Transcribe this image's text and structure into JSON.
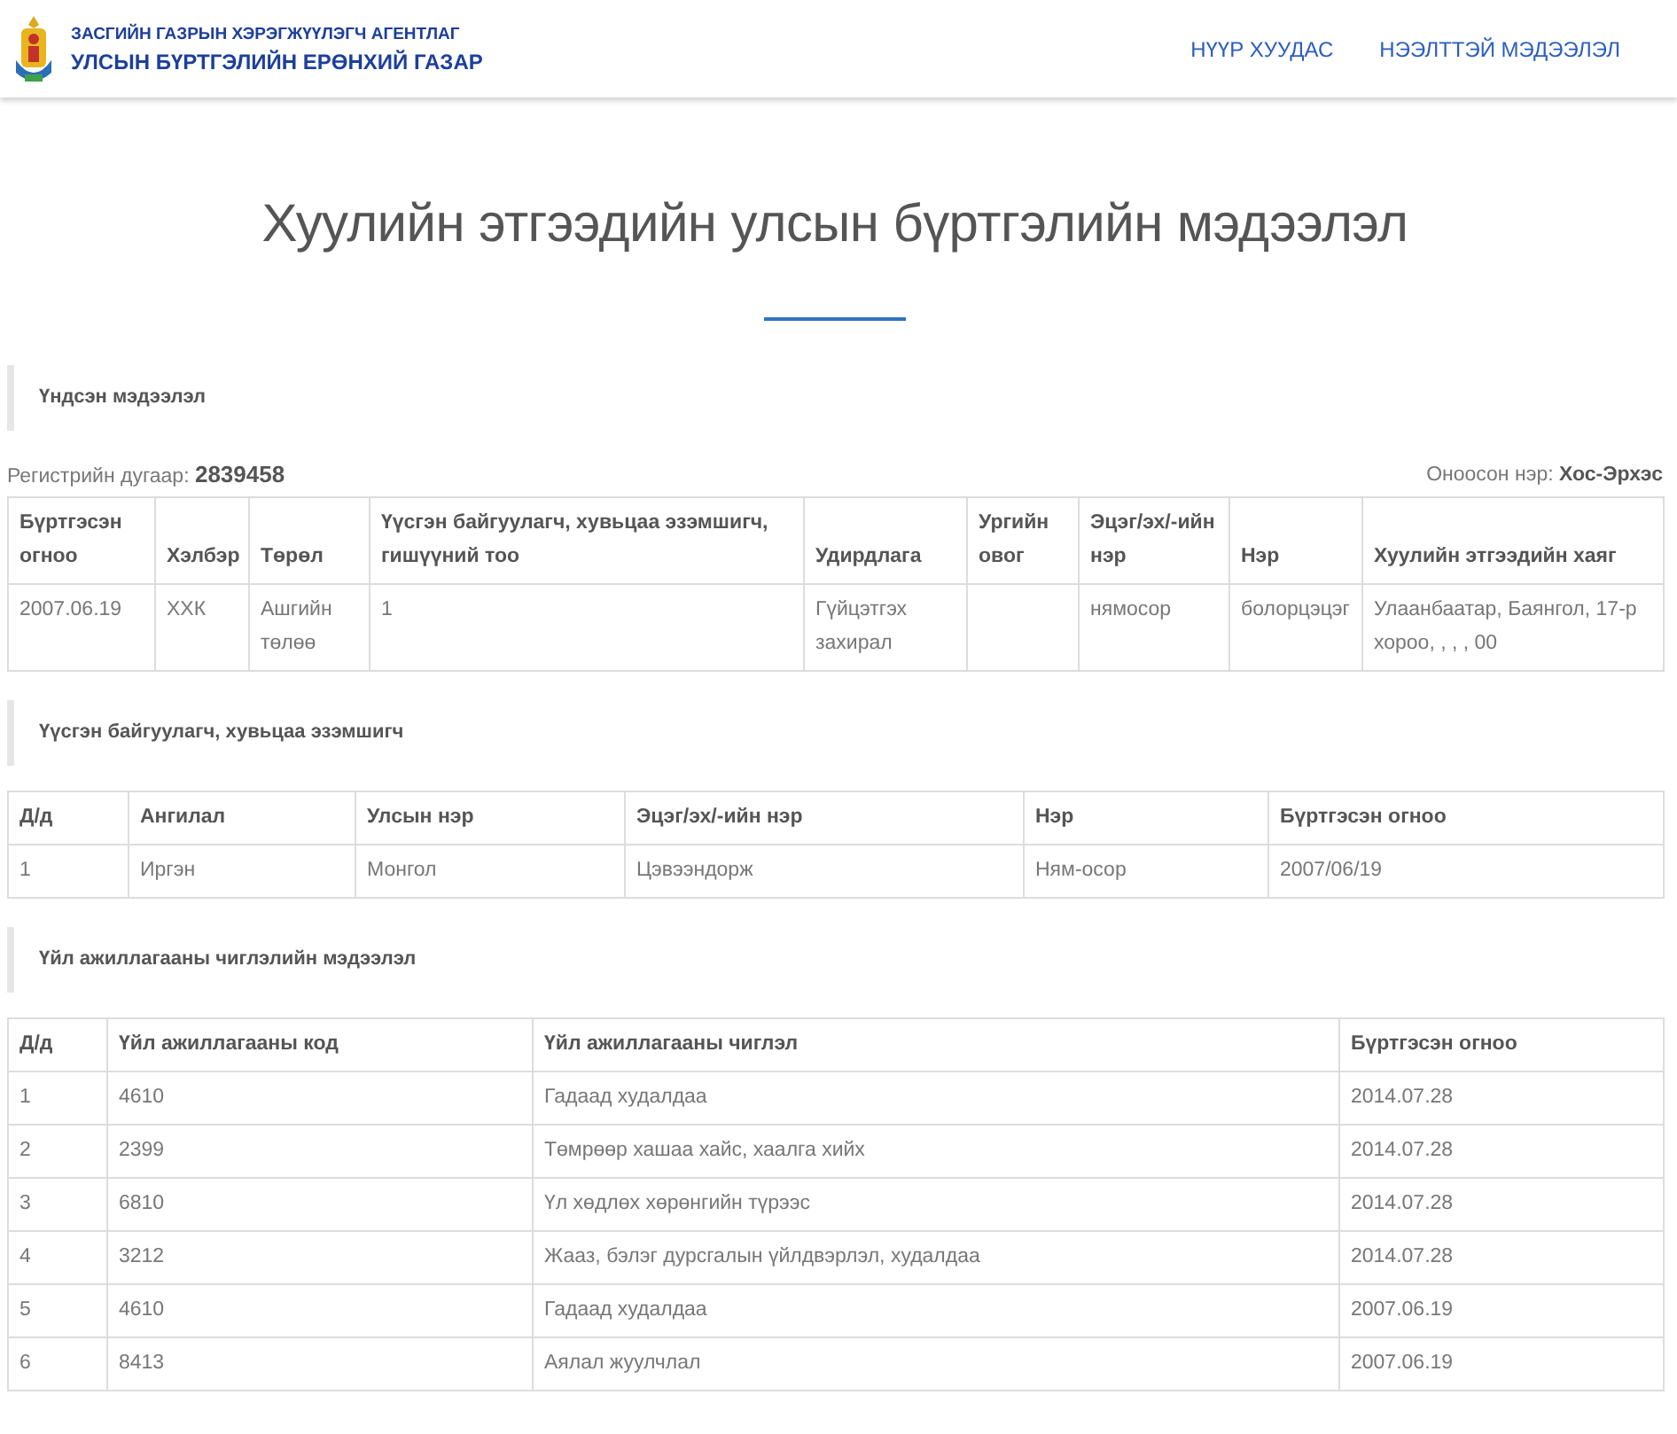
{
  "header": {
    "agency": "ЗАСГИЙН ГАЗРЫН ХЭРЭГЖҮҮЛЭГЧ АГЕНТЛАГ",
    "office": "УЛСЫН БҮРТГЭЛИЙН ЕРӨНХИЙ ГАЗАР",
    "nav": [
      {
        "label": "НҮҮР ХУУДАС"
      },
      {
        "label": "НЭЭЛТТЭЙ МЭДЭЭЛЭЛ"
      }
    ]
  },
  "title": "Хуулийн этгээдийн улсын бүртгэлийн мэдээлэл",
  "sections": [
    {
      "heading": "Үндсэн мэдээлэл",
      "info": {
        "left_label": "Регистрийн дугаар:",
        "left_value": "2839458",
        "right_label": "Оноосон нэр:",
        "right_value": "Хос-Эрхэс"
      },
      "table": {
        "columns": [
          "Бүртгэсэн огноо",
          "Хэлбэр",
          "Төрөл",
          "Үүсгэн байгуулагч, хувьцаа эзэмшигч, гишүүний тоо",
          "Удирдлага",
          "Ургийн овог",
          "Эцэг/эх/-ийн нэр",
          "Нэр",
          "Хуулийн этгээдийн хаяг"
        ],
        "rows": [
          [
            "2007.06.19",
            "ХХК",
            "Ашгийн төлөө",
            "1",
            "Гүйцэтгэх захирал",
            null,
            "нямосор",
            "болорцэцэг",
            "Улаанбаатар, Баянгол, 17-р хороо, , , , 00"
          ]
        ]
      }
    },
    {
      "heading": "Үүсгэн байгуулагч, хувьцаа эзэмшигч",
      "table": {
        "columns": [
          "Д/д",
          "Ангилал",
          "Улсын нэр",
          "Эцэг/эх/-ийн нэр",
          "Нэр",
          "Бүртгэсэн огноо"
        ],
        "rows": [
          [
            "1",
            "Иргэн",
            "Монгол",
            "Цэвээндорж",
            "Ням-осор",
            "2007/06/19"
          ]
        ]
      }
    },
    {
      "heading": "Үйл ажиллагааны чиглэлийн мэдээлэл",
      "table": {
        "columns": [
          "Д/д",
          "Үйл ажиллагааны код",
          "Үйл ажиллагааны чиглэл",
          "Бүртгэсэн огноо"
        ],
        "rows": [
          [
            "1",
            "4610",
            "Гадаад худалдаа",
            "2014.07.28"
          ],
          [
            "2",
            "2399",
            "Төмрөөр хашаа хайс, хаалга хийх",
            "2014.07.28"
          ],
          [
            "3",
            "6810",
            "Үл хөдлөх хөрөнгийн түрээс",
            "2014.07.28"
          ],
          [
            "4",
            "3212",
            "Жааз, бэлэг дурсгалын үйлдвэрлэл, худалдаа",
            "2014.07.28"
          ],
          [
            "5",
            "4610",
            "Гадаад худалдаа",
            "2007.06.19"
          ],
          [
            "6",
            "8413",
            "Аялал жуулчлал",
            "2007.06.19"
          ]
        ]
      }
    }
  ]
}
